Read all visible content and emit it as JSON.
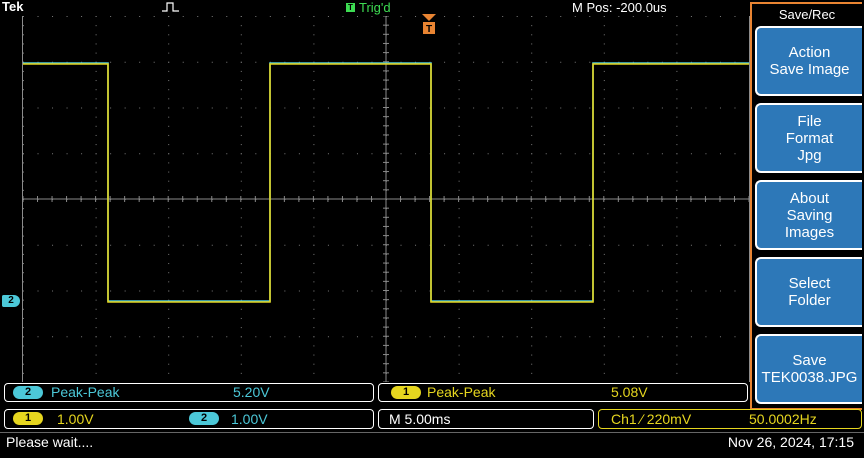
{
  "header": {
    "brand": "Tek",
    "trig_badge": "T",
    "trig_status": "Trig'd",
    "m_pos": "M Pos: -200.0us"
  },
  "waveform": {
    "ch2_marker": "2"
  },
  "sidebar": {
    "title": "Save/Rec",
    "buttons": [
      {
        "line1": "Action",
        "line2": "Save Image",
        "line3": ""
      },
      {
        "line1": "File",
        "line2": "Format",
        "line3": "Jpg"
      },
      {
        "line1": "About",
        "line2": "Saving",
        "line3": "Images"
      },
      {
        "line1": "Select",
        "line2": "Folder",
        "line3": ""
      },
      {
        "line1": "Save",
        "line2": "TEK0038.JPG",
        "line3": ""
      }
    ]
  },
  "measurements": [
    {
      "channel": "2",
      "label": "Peak-Peak",
      "value": "5.20V"
    },
    {
      "channel": "1",
      "label": "Peak-Peak",
      "value": "5.08V"
    }
  ],
  "settings": {
    "ch1_num": "1",
    "ch1_scale": "1.00V",
    "ch2_num": "2",
    "ch2_scale": "1.00V",
    "timebase": "M 5.00ms",
    "trigger": "Ch1 ∕ 220mV",
    "frequency": "50.0002Hz"
  },
  "status": {
    "message": "Please wait....",
    "datetime": "Nov 26, 2024, 17:15"
  },
  "colors": {
    "ch1": "#e6d61f",
    "ch2": "#4cc8d8",
    "accent": "#e88432",
    "button": "#2d78b8"
  }
}
